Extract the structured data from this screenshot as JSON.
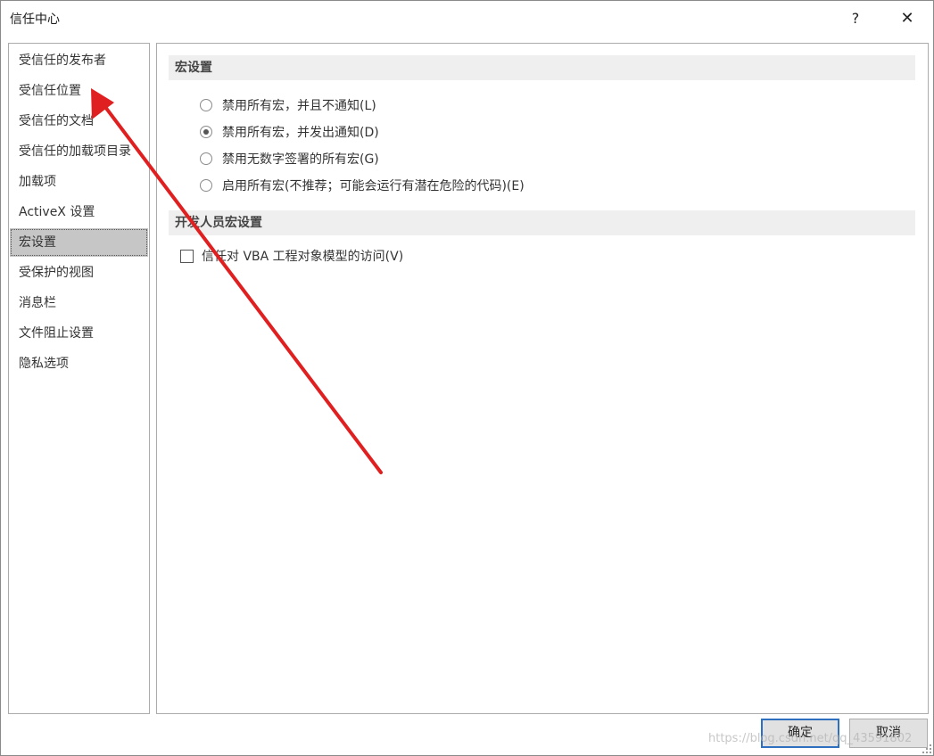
{
  "window": {
    "title": "信任中心",
    "help_label": "?",
    "close_label": "✕"
  },
  "sidebar": {
    "items": [
      {
        "label": "受信任的发布者"
      },
      {
        "label": "受信任位置"
      },
      {
        "label": "受信任的文档"
      },
      {
        "label": "受信任的加载项目录"
      },
      {
        "label": "加载项"
      },
      {
        "label": "ActiveX 设置"
      },
      {
        "label": "宏设置",
        "active": true
      },
      {
        "label": "受保护的视图"
      },
      {
        "label": "消息栏"
      },
      {
        "label": "文件阻止设置"
      },
      {
        "label": "隐私选项"
      }
    ]
  },
  "main": {
    "macro_section_title": "宏设置",
    "options": [
      {
        "label": "禁用所有宏，并且不通知(L)",
        "checked": false
      },
      {
        "label": "禁用所有宏，并发出通知(D)",
        "checked": true
      },
      {
        "label": "禁用无数字签署的所有宏(G)",
        "checked": false
      },
      {
        "label": "启用所有宏(不推荐；可能会运行有潜在危险的代码)(E)",
        "checked": false
      }
    ],
    "developer_section_title": "开发人员宏设置",
    "vba_trust_label": "信任对 VBA 工程对象模型的访问(V)",
    "vba_trust_checked": false
  },
  "footer": {
    "ok_label": "确定",
    "cancel_label": "取消"
  },
  "watermark": "https://blog.csdn.net/qq_43591802",
  "annotation": {
    "arrow_color": "#e02020",
    "icon": "red-arrow"
  }
}
